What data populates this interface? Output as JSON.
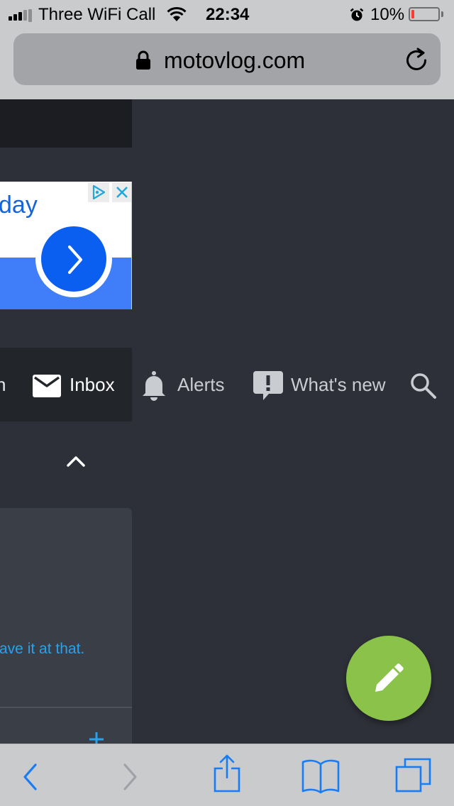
{
  "status_bar": {
    "carrier": "Three WiFi Call",
    "time": "22:34",
    "battery_percent": "10%",
    "battery_level": 0.1,
    "icons": [
      "signal-icon",
      "wifi-icon",
      "alarm-icon",
      "battery-icon"
    ]
  },
  "address_bar": {
    "url": "motovlog.com",
    "icons": [
      "lock-icon",
      "reload-icon"
    ]
  },
  "ad": {
    "text": "day",
    "icons": [
      "adchoices-icon",
      "close-icon",
      "chevron-right-icon"
    ],
    "colors": {
      "brand_blue": "#0b5ff0",
      "band_blue": "#3f7ef8",
      "text_blue": "#1565d8"
    }
  },
  "nav": {
    "partial_label": "n",
    "items": [
      {
        "label": "Inbox",
        "icon": "envelope-icon"
      },
      {
        "label": "Alerts",
        "icon": "bell-icon"
      },
      {
        "label": "What's new",
        "icon": "speech-bubble-exclamation-icon"
      }
    ],
    "search_icon": "search-icon"
  },
  "content": {
    "collapse_icon": "chevron-up-icon",
    "card_link_text": "ave it at that.",
    "card_action_icon": "plus-icon"
  },
  "fab": {
    "icon": "pencil-icon",
    "color": "#8bc34a"
  },
  "toolbar": {
    "icons": [
      "back-icon",
      "forward-icon",
      "share-icon",
      "bookmarks-icon",
      "tabs-icon"
    ],
    "accent": "#1a7cf5"
  },
  "theme": {
    "page_bg": "#2d3038",
    "chrome_bg": "#c9cbcd",
    "link_color": "#2aa1ee"
  }
}
